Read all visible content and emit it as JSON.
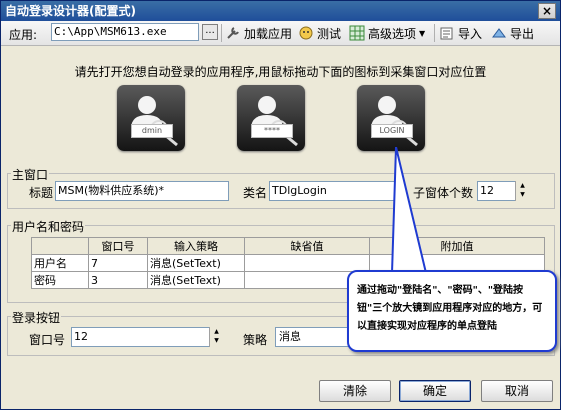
{
  "window": {
    "title": "自动登录设计器(配置式)",
    "close_label": "×"
  },
  "toolbar": {
    "app_label": "应用:",
    "app_path": "C:\\App\\MSM613.exe",
    "browse_label": "...",
    "load_label": "加载应用",
    "test_label": "测试",
    "advanced_label": "高级选项",
    "import_label": "导入",
    "export_label": "导出"
  },
  "instruction": "请先打开您想自动登录的应用程序,用鼠标拖动下面的图标到采集窗口对应位置",
  "drag_tiles": [
    {
      "caption": "dmin"
    },
    {
      "caption": "****"
    },
    {
      "caption": "LOGIN"
    }
  ],
  "main_window": {
    "group_title": "主窗口",
    "title_label": "标题",
    "title_value": "MSM(物料供应系统)*",
    "class_label": "类名",
    "class_value": "TDlgLogin",
    "child_count_label": "子窗体个数",
    "child_count_value": "12"
  },
  "credentials": {
    "group_title": "用户名和密码",
    "columns": [
      "",
      "窗口号",
      "输入策略",
      "缺省值",
      "附加值"
    ],
    "rows": [
      {
        "label": "用户名",
        "window_no": "7",
        "strategy": "消息(SetText)",
        "default": "",
        "extra": ""
      },
      {
        "label": "密码",
        "window_no": "3",
        "strategy": "消息(SetText)",
        "default": "",
        "extra": ""
      }
    ]
  },
  "login_button": {
    "group_title": "登录按钮",
    "window_no_label": "窗口号",
    "window_no_value": "12",
    "strategy_label": "策略",
    "strategy_value": "消息"
  },
  "callout": {
    "text": "通过拖动\"登陆名\"、\"密码\"、\"登陆按钮\"三个放大镜到应用程序对应的地方，可以直接实现对应程序的单点登陆"
  },
  "buttons": {
    "clear": "清除",
    "ok": "确定",
    "cancel": "取消"
  }
}
